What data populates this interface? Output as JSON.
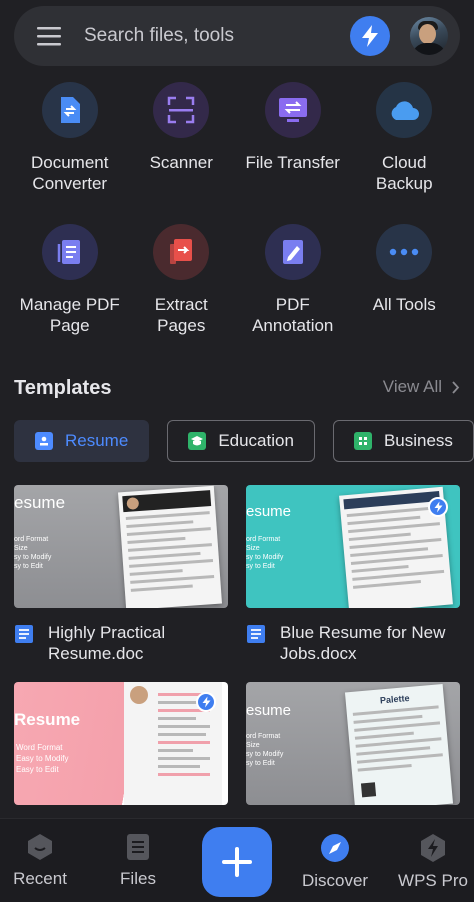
{
  "search": {
    "placeholder": "Search files, tools"
  },
  "tools": [
    {
      "label": "Document\nConverter",
      "icon": "document-converter-icon"
    },
    {
      "label": "Scanner",
      "icon": "scanner-icon"
    },
    {
      "label": "File Transfer",
      "icon": "file-transfer-icon"
    },
    {
      "label": "Cloud\nBackup",
      "icon": "cloud-backup-icon"
    },
    {
      "label": "Manage PDF\nPage",
      "icon": "manage-pdf-icon"
    },
    {
      "label": "Extract\nPages",
      "icon": "extract-pages-icon"
    },
    {
      "label": "PDF\nAnnotation",
      "icon": "pdf-annotation-icon"
    },
    {
      "label": "All Tools",
      "icon": "all-tools-icon"
    }
  ],
  "templates": {
    "title": "Templates",
    "view_all": "View All",
    "chips": [
      {
        "label": "Resume",
        "active": true
      },
      {
        "label": "Education",
        "active": false
      },
      {
        "label": "Business",
        "active": false
      }
    ],
    "cards": [
      {
        "name": "Highly Practical Resume.doc",
        "thumb_title": "esume",
        "thumb_lines": [
          "ord Format",
          "Size",
          "sy to Modify",
          "sy to Edit"
        ]
      },
      {
        "name": "Blue Resume for New Jobs.docx",
        "thumb_title": "esume",
        "thumb_lines": [
          "ord Format",
          "Size",
          "sy to Modify",
          "sy to Edit"
        ]
      },
      {
        "name": "",
        "thumb_title": "Resume",
        "thumb_lines": [
          "Word Format",
          "Easy to Modify",
          "Easy to Edit"
        ]
      },
      {
        "name": "",
        "thumb_title": "esume",
        "thumb_lines": [
          "ord Format",
          "Size",
          "sy to Modify",
          "sy to Edit"
        ],
        "paper_title": "Palette"
      }
    ]
  },
  "nav": [
    {
      "label": "Recent",
      "icon": "recent-icon",
      "active": false
    },
    {
      "label": "Files",
      "icon": "files-icon",
      "active": false
    },
    {
      "label": "Discover",
      "icon": "discover-compass-icon",
      "active": true
    },
    {
      "label": "WPS Pro",
      "icon": "wps-pro-icon",
      "active": false
    }
  ],
  "colors": {
    "accent": "#3f7ef0",
    "background": "#202024",
    "teal": "#3fc4c0",
    "pink": "#f5a3ad"
  }
}
